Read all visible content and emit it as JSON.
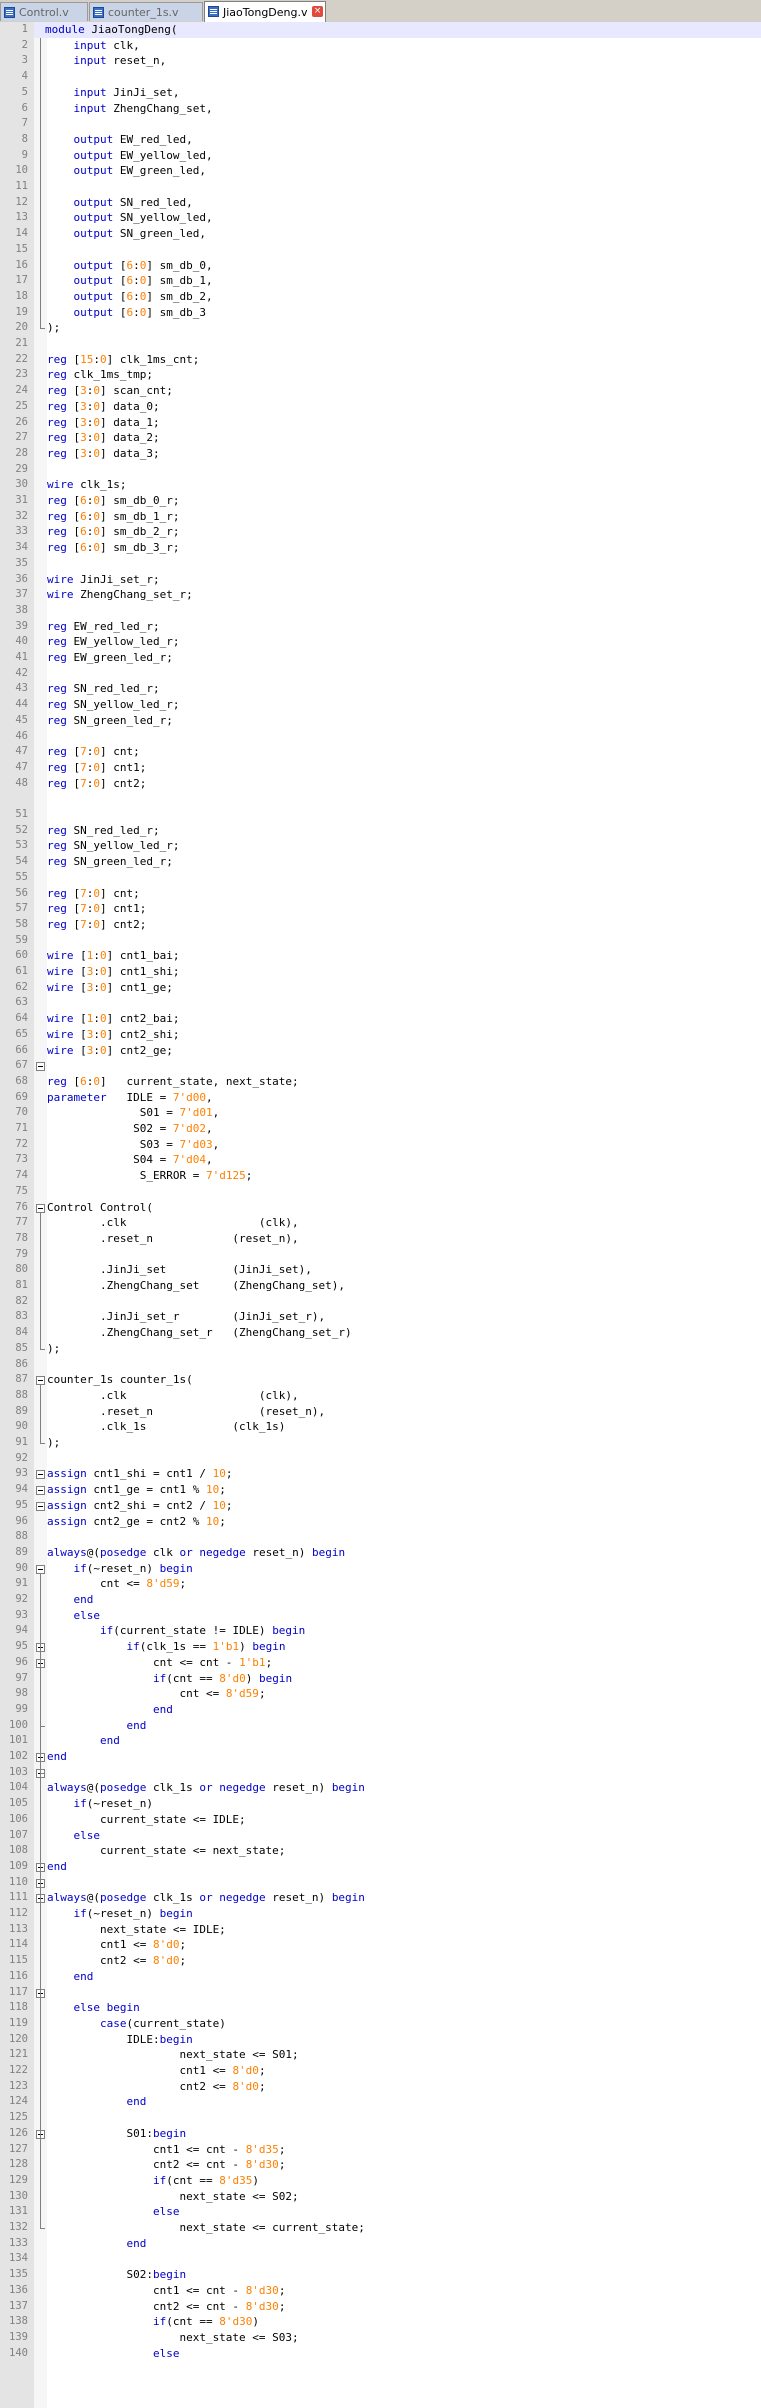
{
  "tabs": [
    {
      "label": "Control.v",
      "active": false
    },
    {
      "label": "counter_1s.v",
      "active": false
    },
    {
      "label": "JiaoTongDeng.v",
      "active": true
    }
  ],
  "close_glyph": "×",
  "colors": {
    "keyword": "#0000c8",
    "number": "#ff8000",
    "current_line": "#e8e8ff"
  },
  "lines": [
    {
      "n": "1",
      "t": "module JiaoTongDeng("
    },
    {
      "n": "2",
      "t": "    input clk,"
    },
    {
      "n": "3",
      "t": "    input reset_n,"
    },
    {
      "n": "4",
      "t": ""
    },
    {
      "n": "5",
      "t": "    input JinJi_set,"
    },
    {
      "n": "6",
      "t": "    input ZhengChang_set,"
    },
    {
      "n": "7",
      "t": ""
    },
    {
      "n": "8",
      "t": "    output EW_red_led,"
    },
    {
      "n": "9",
      "t": "    output EW_yellow_led,"
    },
    {
      "n": "10",
      "t": "    output EW_green_led,"
    },
    {
      "n": "11",
      "t": ""
    },
    {
      "n": "12",
      "t": "    output SN_red_led,"
    },
    {
      "n": "13",
      "t": "    output SN_yellow_led,"
    },
    {
      "n": "14",
      "t": "    output SN_green_led,"
    },
    {
      "n": "15",
      "t": ""
    },
    {
      "n": "16",
      "t": "    output [6:0] sm_db_0,"
    },
    {
      "n": "17",
      "t": "    output [6:0] sm_db_1,"
    },
    {
      "n": "18",
      "t": "    output [6:0] sm_db_2,"
    },
    {
      "n": "19",
      "t": "    output [6:0] sm_db_3"
    },
    {
      "n": "20",
      "t": ");"
    },
    {
      "n": "21",
      "t": ""
    },
    {
      "n": "22",
      "t": "reg [15:0] clk_1ms_cnt;"
    },
    {
      "n": "23",
      "t": "reg clk_1ms_tmp;"
    },
    {
      "n": "24",
      "t": "reg [3:0] scan_cnt;"
    },
    {
      "n": "25",
      "t": "reg [3:0] data_0;"
    },
    {
      "n": "26",
      "t": "reg [3:0] data_1;"
    },
    {
      "n": "27",
      "t": "reg [3:0] data_2;"
    },
    {
      "n": "28",
      "t": "reg [3:0] data_3;"
    },
    {
      "n": "29",
      "t": ""
    },
    {
      "n": "30",
      "t": "wire clk_1s;"
    },
    {
      "n": "31",
      "t": "reg [6:0] sm_db_0_r;"
    },
    {
      "n": "32",
      "t": "reg [6:0] sm_db_1_r;"
    },
    {
      "n": "33",
      "t": "reg [6:0] sm_db_2_r;"
    },
    {
      "n": "34",
      "t": "reg [6:0] sm_db_3_r;"
    },
    {
      "n": "35",
      "t": ""
    },
    {
      "n": "36",
      "t": "wire JinJi_set_r;"
    },
    {
      "n": "37",
      "t": "wire ZhengChang_set_r;"
    },
    {
      "n": "38",
      "t": ""
    },
    {
      "n": "39",
      "t": "reg EW_red_led_r;"
    },
    {
      "n": "40",
      "t": "reg EW_yellow_led_r;"
    },
    {
      "n": "41",
      "t": "reg EW_green_led_r;"
    },
    {
      "n": "42",
      "t": ""
    },
    {
      "n": "43",
      "t": "reg SN_red_led_r;"
    },
    {
      "n": "44",
      "t": "reg SN_yellow_led_r;"
    },
    {
      "n": "45",
      "t": "reg SN_green_led_r;"
    },
    {
      "n": "46",
      "t": ""
    },
    {
      "n": "47",
      "t": "reg [7:0] cnt;"
    },
    {
      "n": "47",
      "t": "reg [7:0] cnt1;"
    },
    {
      "n": "48",
      "t": "reg [7:0] cnt2;"
    },
    {
      "n": "",
      "t": ""
    },
    {
      "n": "51",
      "t": ""
    },
    {
      "n": "52",
      "t": "reg SN_red_led_r;"
    },
    {
      "n": "53",
      "t": "reg SN_yellow_led_r;"
    },
    {
      "n": "54",
      "t": "reg SN_green_led_r;"
    },
    {
      "n": "55",
      "t": ""
    },
    {
      "n": "56",
      "t": "reg [7:0] cnt;"
    },
    {
      "n": "57",
      "t": "reg [7:0] cnt1;"
    },
    {
      "n": "58",
      "t": "reg [7:0] cnt2;"
    },
    {
      "n": "59",
      "t": ""
    },
    {
      "n": "60",
      "t": "wire [1:0] cnt1_bai;"
    },
    {
      "n": "61",
      "t": "wire [3:0] cnt1_shi;"
    },
    {
      "n": "62",
      "t": "wire [3:0] cnt1_ge;"
    },
    {
      "n": "63",
      "t": ""
    },
    {
      "n": "64",
      "t": "wire [1:0] cnt2_bai;"
    },
    {
      "n": "65",
      "t": "wire [3:0] cnt2_shi;"
    },
    {
      "n": "66",
      "t": "wire [3:0] cnt2_ge;"
    },
    {
      "n": "67",
      "t": ""
    },
    {
      "n": "68",
      "t": "reg [6:0]   current_state, next_state;"
    },
    {
      "n": "69",
      "t": "parameter   IDLE = 7'd00,"
    },
    {
      "n": "70",
      "t": "              S01 = 7'd01,"
    },
    {
      "n": "71",
      "t": "             S02 = 7'd02,"
    },
    {
      "n": "72",
      "t": "              S03 = 7'd03,"
    },
    {
      "n": "73",
      "t": "             S04 = 7'd04,"
    },
    {
      "n": "74",
      "t": "              S_ERROR = 7'd125;"
    },
    {
      "n": "75",
      "t": ""
    },
    {
      "n": "76",
      "t": "Control Control("
    },
    {
      "n": "77",
      "t": "        .clk                    (clk),"
    },
    {
      "n": "78",
      "t": "        .reset_n            (reset_n),"
    },
    {
      "n": "79",
      "t": ""
    },
    {
      "n": "80",
      "t": "        .JinJi_set          (JinJi_set),"
    },
    {
      "n": "81",
      "t": "        .ZhengChang_set     (ZhengChang_set),"
    },
    {
      "n": "82",
      "t": ""
    },
    {
      "n": "83",
      "t": "        .JinJi_set_r        (JinJi_set_r),"
    },
    {
      "n": "84",
      "t": "        .ZhengChang_set_r   (ZhengChang_set_r)"
    },
    {
      "n": "85",
      "t": ");"
    },
    {
      "n": "86",
      "t": ""
    },
    {
      "n": "87",
      "t": "counter_1s counter_1s("
    },
    {
      "n": "88",
      "t": "        .clk                    (clk),"
    },
    {
      "n": "89",
      "t": "        .reset_n                (reset_n),"
    },
    {
      "n": "90",
      "t": "        .clk_1s             (clk_1s)"
    },
    {
      "n": "91",
      "t": ");"
    },
    {
      "n": "92",
      "t": ""
    },
    {
      "n": "93",
      "t": "assign cnt1_shi = cnt1 / 10;"
    },
    {
      "n": "94",
      "t": "assign cnt1_ge = cnt1 % 10;"
    },
    {
      "n": "95",
      "t": "assign cnt2_shi = cnt2 / 10;"
    },
    {
      "n": "96",
      "t": "assign cnt2_ge = cnt2 % 10;"
    },
    {
      "n": "88",
      "t": ""
    },
    {
      "n": "89",
      "t": "always@(posedge clk or negedge reset_n) begin"
    },
    {
      "n": "90",
      "t": "    if(~reset_n) begin"
    },
    {
      "n": "91",
      "t": "        cnt <= 8'd59;"
    },
    {
      "n": "92",
      "t": "    end"
    },
    {
      "n": "93",
      "t": "    else"
    },
    {
      "n": "94",
      "t": "        if(current_state != IDLE) begin"
    },
    {
      "n": "95",
      "t": "            if(clk_1s == 1'b1) begin"
    },
    {
      "n": "96",
      "t": "                cnt <= cnt - 1'b1;"
    },
    {
      "n": "97",
      "t": "                if(cnt == 8'd0) begin"
    },
    {
      "n": "98",
      "t": "                    cnt <= 8'd59;"
    },
    {
      "n": "99",
      "t": "                end"
    },
    {
      "n": "100",
      "t": "            end"
    },
    {
      "n": "101",
      "t": "        end"
    },
    {
      "n": "102",
      "t": "end"
    },
    {
      "n": "103",
      "t": ""
    },
    {
      "n": "104",
      "t": "always@(posedge clk_1s or negedge reset_n) begin"
    },
    {
      "n": "105",
      "t": "    if(~reset_n)"
    },
    {
      "n": "106",
      "t": "        current_state <= IDLE;"
    },
    {
      "n": "107",
      "t": "    else"
    },
    {
      "n": "108",
      "t": "        current_state <= next_state;"
    },
    {
      "n": "109",
      "t": "end"
    },
    {
      "n": "110",
      "t": ""
    },
    {
      "n": "111",
      "t": "always@(posedge clk_1s or negedge reset_n) begin"
    },
    {
      "n": "112",
      "t": "    if(~reset_n) begin"
    },
    {
      "n": "113",
      "t": "        next_state <= IDLE;"
    },
    {
      "n": "114",
      "t": "        cnt1 <= 8'd0;"
    },
    {
      "n": "115",
      "t": "        cnt2 <= 8'd0;"
    },
    {
      "n": "116",
      "t": "    end"
    },
    {
      "n": "117",
      "t": ""
    },
    {
      "n": "118",
      "t": "    else begin"
    },
    {
      "n": "119",
      "t": "        case(current_state)"
    },
    {
      "n": "120",
      "t": "            IDLE:begin"
    },
    {
      "n": "121",
      "t": "                    next_state <= S01;"
    },
    {
      "n": "122",
      "t": "                    cnt1 <= 8'd0;"
    },
    {
      "n": "123",
      "t": "                    cnt2 <= 8'd0;"
    },
    {
      "n": "124",
      "t": "            end"
    },
    {
      "n": "125",
      "t": ""
    },
    {
      "n": "126",
      "t": "            S01:begin"
    },
    {
      "n": "127",
      "t": "                cnt1 <= cnt - 8'd35;"
    },
    {
      "n": "128",
      "t": "                cnt2 <= cnt - 8'd30;"
    },
    {
      "n": "129",
      "t": "                if(cnt == 8'd35)"
    },
    {
      "n": "130",
      "t": "                    next_state <= S02;"
    },
    {
      "n": "131",
      "t": "                else"
    },
    {
      "n": "132",
      "t": "                    next_state <= current_state;"
    },
    {
      "n": "133",
      "t": "            end"
    },
    {
      "n": "134",
      "t": ""
    },
    {
      "n": "135",
      "t": "            S02:begin"
    },
    {
      "n": "136",
      "t": "                cnt1 <= cnt - 8'd30;"
    },
    {
      "n": "137",
      "t": "                cnt2 <= cnt - 8'd30;"
    },
    {
      "n": "138",
      "t": "                if(cnt == 8'd30)"
    },
    {
      "n": "139",
      "t": "                    next_state <= S03;"
    },
    {
      "n": "140",
      "t": "                else"
    }
  ]
}
